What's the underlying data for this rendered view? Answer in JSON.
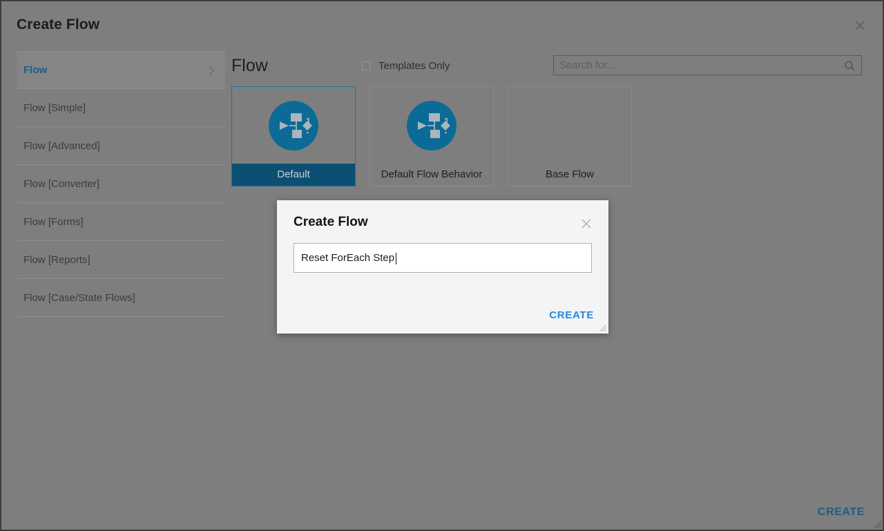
{
  "window": {
    "title": "Create Flow",
    "close_icon": "close-icon"
  },
  "sidebar": {
    "items": [
      {
        "label": "Flow",
        "active": true,
        "chevron": "chevron-right-icon"
      },
      {
        "label": "Flow [Simple]",
        "active": false
      },
      {
        "label": "Flow [Advanced]",
        "active": false
      },
      {
        "label": "Flow [Converter]",
        "active": false
      },
      {
        "label": "Flow [Forms]",
        "active": false
      },
      {
        "label": "Flow [Reports]",
        "active": false
      },
      {
        "label": "Flow [Case/State Flows]",
        "active": false
      }
    ]
  },
  "main": {
    "title": "Flow",
    "templates_only": {
      "label": "Templates Only",
      "checked": false
    },
    "search": {
      "value": "",
      "placeholder": "Search for...",
      "icon": "search-icon"
    },
    "cards": [
      {
        "label": "Default",
        "selected": true,
        "has_icon": true,
        "icon": "flow-diagram-icon"
      },
      {
        "label": "Default Flow Behavior",
        "selected": false,
        "has_icon": true,
        "icon": "flow-diagram-icon"
      },
      {
        "label": "Base Flow",
        "selected": false,
        "has_icon": false
      }
    ]
  },
  "footer": {
    "create_label": "CREATE"
  },
  "modal": {
    "title": "Create Flow",
    "close_icon": "close-icon",
    "name_input": {
      "value": "Reset ForEach Step",
      "placeholder": ""
    },
    "create_label": "CREATE"
  },
  "colors": {
    "overlay": "#7e7e7e",
    "accent_blue": "#0b6b96",
    "link_blue": "#1e88e5",
    "selected_band": "#0b4f73",
    "footer_create": "#1b5d86"
  }
}
